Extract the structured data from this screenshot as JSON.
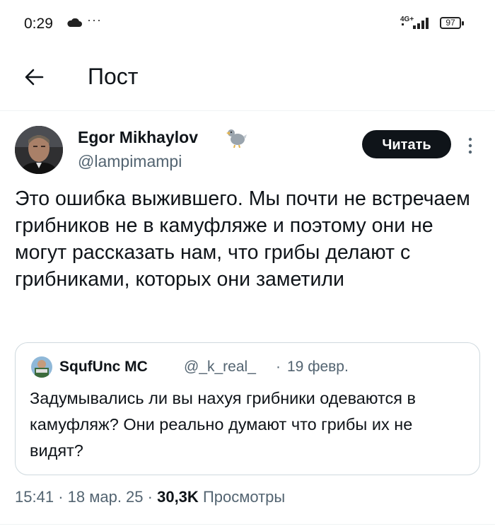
{
  "status_bar": {
    "time": "0:29",
    "more": "···",
    "network": "4G+",
    "battery": "97"
  },
  "header": {
    "title": "Пост",
    "back_icon": "arrow-left-icon"
  },
  "author": {
    "name": "Egor Mikhaylov",
    "handle": "@lampimampi",
    "badge_icon": "dodo-bird-icon",
    "follow_label": "Читать"
  },
  "tweet": {
    "text": "Это ошибка выжившего. Мы почти не встречаем грибников не в камуфляже и поэтому они не могут рассказать нам, что грибы делают с грибниками, которых они заметили"
  },
  "quote": {
    "name": "SqufUnc MC",
    "handle": "@_k_real_",
    "separator": "·",
    "date": "19 февр.",
    "text": "Задумывались ли вы нахуя грибники одеваются в камуфляж? Они реально думают что грибы их не видят?"
  },
  "meta": {
    "time": "15:41",
    "separator": "·",
    "date": "18 мар. 25",
    "views_count": "30,3K",
    "views_label": "Просмотры"
  },
  "colors": {
    "text_primary": "#0f1419",
    "text_secondary": "#536471",
    "border": "#cfd9de"
  }
}
